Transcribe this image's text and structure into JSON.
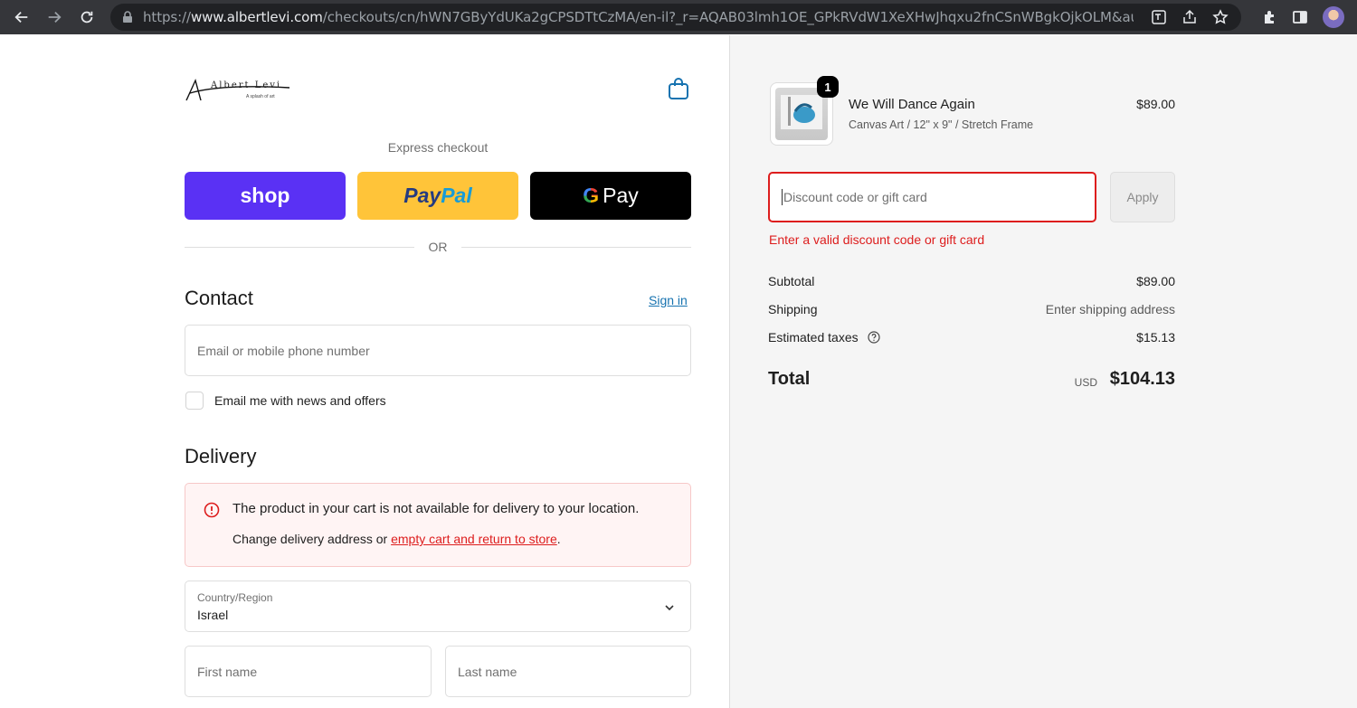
{
  "browser": {
    "url_prefix": "https://",
    "url_host": "www.albertlevi.com",
    "url_path": "/checkouts/cn/hWN7GByYdUKa2gCPSDTtCzMA/en-il?_r=AQAB03lmh1OE_GPkRVdW1XeXHwJhqxu2fnCSnWBgkOjkOLM&auto_redi..."
  },
  "brand": {
    "logo_text": "Albert Levi",
    "logo_tagline": "A splash of art"
  },
  "express": {
    "title": "Express checkout",
    "shop_label": "shop",
    "paypal_label_1": "Pay",
    "paypal_label_2": "Pal",
    "gpay_g": "G",
    "gpay_label": "Pay",
    "or_label": "OR"
  },
  "contact": {
    "heading": "Contact",
    "sign_in": "Sign in",
    "email_placeholder": "Email or mobile phone number",
    "newsletter_label": "Email me with news and offers"
  },
  "delivery": {
    "heading": "Delivery",
    "alert_title": "The product in your cart is not available for delivery to your location.",
    "alert_body_prefix": "Change delivery address or ",
    "alert_link": "empty cart and return to store",
    "alert_body_suffix": ".",
    "country_label": "Country/Region",
    "country_value": "Israel",
    "first_name_placeholder": "First name",
    "last_name_placeholder": "Last name"
  },
  "order": {
    "item": {
      "quantity": "1",
      "title": "We Will Dance Again",
      "variant": "Canvas Art / 12\" x 9\" / Stretch Frame",
      "price": "$89.00"
    },
    "discount_placeholder": "Discount code or gift card",
    "apply_label": "Apply",
    "discount_error": "Enter a valid discount code or gift card",
    "subtotal_label": "Subtotal",
    "subtotal_value": "$89.00",
    "shipping_label": "Shipping",
    "shipping_value": "Enter shipping address",
    "taxes_label": "Estimated taxes",
    "taxes_value": "$15.13",
    "total_label": "Total",
    "total_currency": "USD",
    "total_value": "$104.13"
  },
  "colors": {
    "shop": "#5a31f4",
    "paypal": "#ffc439",
    "error": "#dd1d1d",
    "link": "#1773b0"
  }
}
